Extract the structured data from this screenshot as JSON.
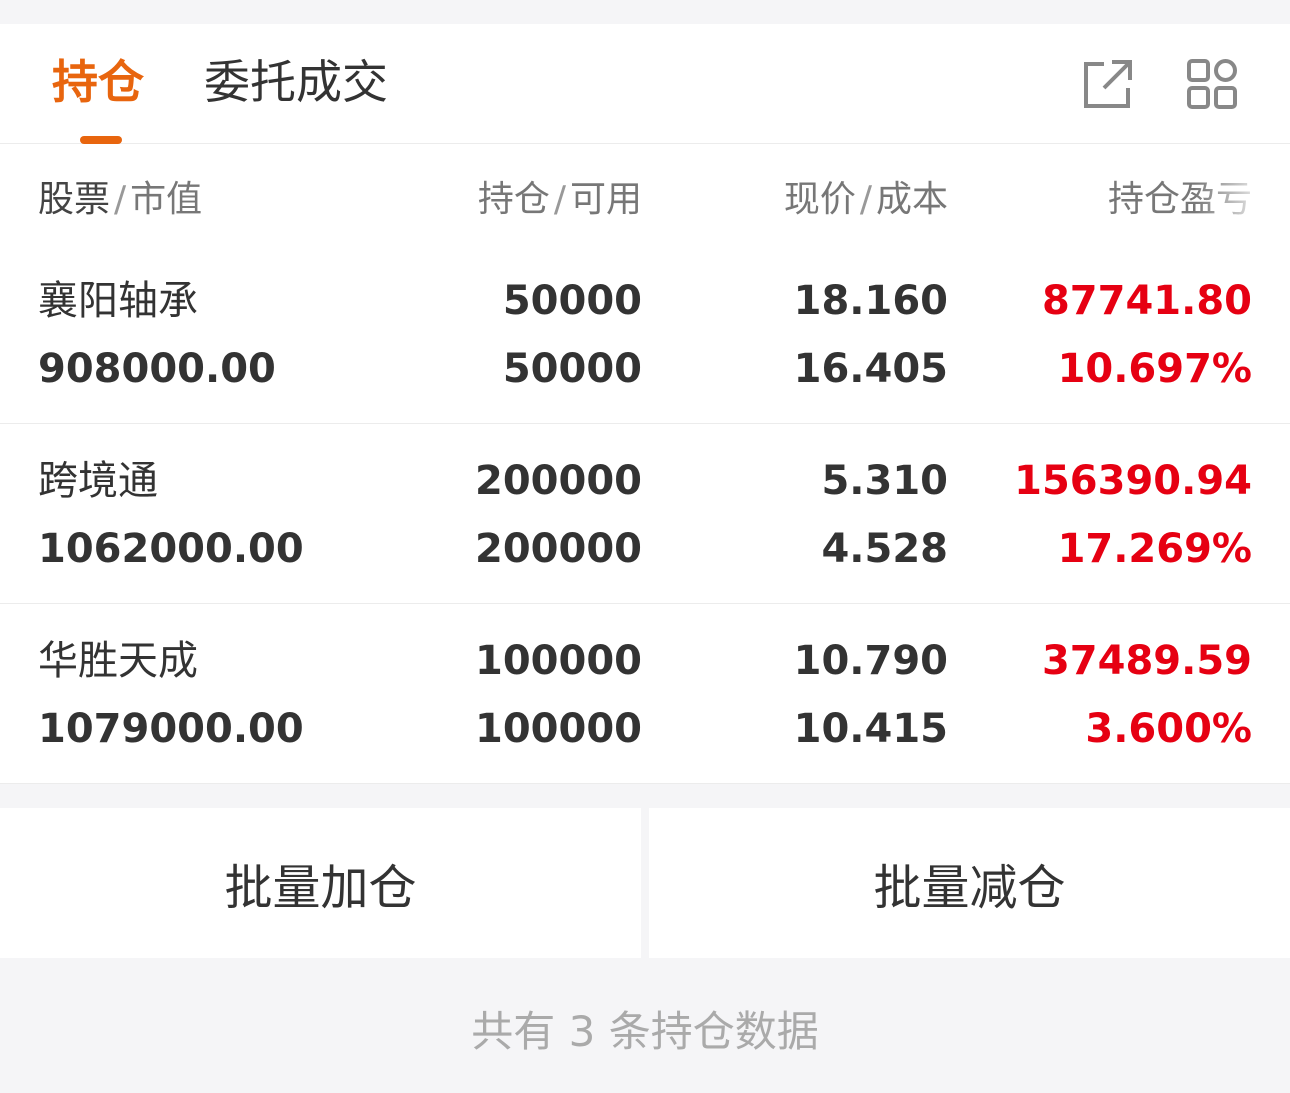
{
  "tabs": {
    "holding": "持仓",
    "orders": "委托成交"
  },
  "icons": {
    "share": "external-link-icon",
    "grid": "grid-icon"
  },
  "colors": {
    "accent": "#e8650e",
    "profit": "#e60012"
  },
  "table_header": {
    "col1_main": "股票",
    "col1_sub": "市值",
    "col2_main": "持仓",
    "col2_sub": "可用",
    "col3_main": "现价",
    "col3_sub": "成本",
    "col4_main": "持仓盈亏"
  },
  "rows": [
    {
      "name": "襄阳轴承",
      "market_value": "908000.00",
      "position": "50000",
      "available": "50000",
      "price": "18.160",
      "cost": "16.405",
      "pnl": "87741.80",
      "pnl_pct": "10.697%"
    },
    {
      "name": "跨境通",
      "market_value": "1062000.00",
      "position": "200000",
      "available": "200000",
      "price": "5.310",
      "cost": "4.528",
      "pnl": "156390.94",
      "pnl_pct": "17.269%"
    },
    {
      "name": "华胜天成",
      "market_value": "1079000.00",
      "position": "100000",
      "available": "100000",
      "price": "10.790",
      "cost": "10.415",
      "pnl": "37489.59",
      "pnl_pct": "3.600%"
    }
  ],
  "buttons": {
    "batch_add": "批量加仓",
    "batch_reduce": "批量减仓"
  },
  "footer": "共有 3 条持仓数据"
}
